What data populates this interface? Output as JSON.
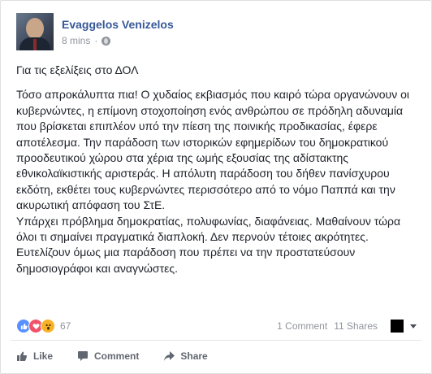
{
  "author": {
    "name": "Evaggelos Venizelos",
    "time": "8 mins",
    "separator": "·",
    "privacy_icon": "globe-icon"
  },
  "post": {
    "title": "Για τις εξελίξεις στο ΔΟΛ",
    "paragraphs": [
      "Τόσο απροκάλυπτα πια! Ο χυδαίος εκβιασμός που καιρό τώρα οργανώνουν οι κυβερνώντες, η επίμονη στοχοποίηση ενός ανθρώπου σε πρόδηλη αδυναμία που βρίσκεται επιπλέον υπό την πίεση της ποινικής προδικασίας, έφερε αποτέλεσμα. Την παράδοση των ιστορικών εφημερίδων του δημοκρατικού προοδευτικού χώρου στα χέρια της ωμής εξουσίας της αδίστακτης εθνικολαϊκιστικής αριστεράς. Η απόλυτη παράδοση του δήθεν πανίσχυρου εκδότη, εκθέτει τους κυβερνώντες περισσότερο από το νόμο Παππά και την ακυρωτική απόφαση του ΣτΕ.",
      "Υπάρχει πρόβλημα δημοκρατίας, πολυφωνίας, διαφάνειας. Μαθαίνουν τώρα όλοι τι σημαίνει πραγματικά διαπλοκή. Δεν περνούν τέτοιες ακρότητες. Ευτελίζουν όμως μια παράδοση που πρέπει να την προστατεύσουν δημοσιογράφοι και αναγνώστες."
    ]
  },
  "stats": {
    "reaction_icons": [
      "like-reaction-icon",
      "love-reaction-icon",
      "wow-reaction-icon"
    ],
    "reaction_count": "67",
    "comments": "1 Comment",
    "shares": "11 Shares"
  },
  "actions": {
    "like": "Like",
    "comment": "Comment",
    "share": "Share"
  },
  "colors": {
    "link": "#365899",
    "text": "#1d2129",
    "muted": "#90949c",
    "like_blue": "#5890ff",
    "love_red": "#f25268",
    "wow_yellow": "#f7b125"
  }
}
